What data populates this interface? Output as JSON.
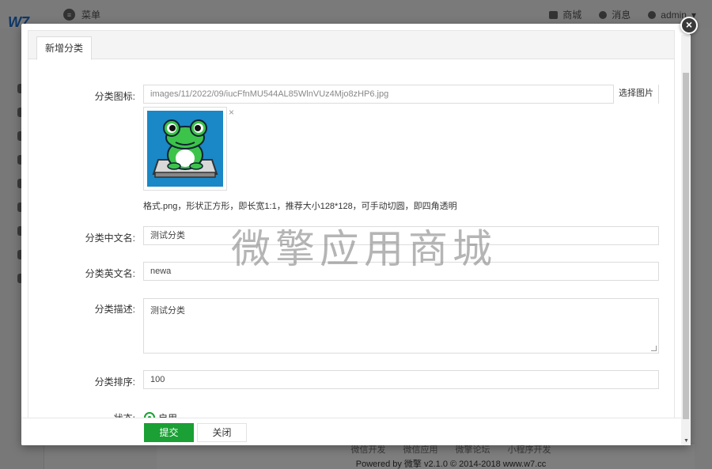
{
  "app": {
    "logo": "W7",
    "menu_label": "菜单",
    "top_right": {
      "store": "商城",
      "messages": "消息",
      "user": "admin"
    }
  },
  "footer": {
    "links": [
      "微信开发",
      "微信应用",
      "微擎论坛",
      "小程序开发"
    ],
    "powered": "Powered by 微擎 v2.1.0 © 2014-2018 www.w7.cc"
  },
  "modal": {
    "tab_label": "新增分类",
    "fields": {
      "icon_label": "分类图标:",
      "icon_path": "images/11/2022/09/iucFfnMU544AL85WlnVUz4Mjo8zHP6.jpg",
      "select_image_label": "选择图片",
      "remove_label": "×",
      "hint": "格式.png，形状正方形，即长宽1:1，推荐大小128*128，可手动切圆，即四角透明",
      "cn_name_label": "分类中文名:",
      "cn_name_value": "测试分类",
      "en_name_label": "分类英文名:",
      "en_name_value": "newa",
      "desc_label": "分类描述:",
      "desc_value": "测试分类",
      "sort_label": "分类排序:",
      "sort_value": "100",
      "status_label": "状态:",
      "status_option": "启用"
    },
    "watermark": "微擎应用商城",
    "buttons": {
      "submit": "提交",
      "close": "关闭"
    },
    "close_icon": "×"
  },
  "colors": {
    "primary_green": "#1aa034",
    "brand_blue": "#1e6fcf",
    "image_bg": "#1a87c6"
  }
}
